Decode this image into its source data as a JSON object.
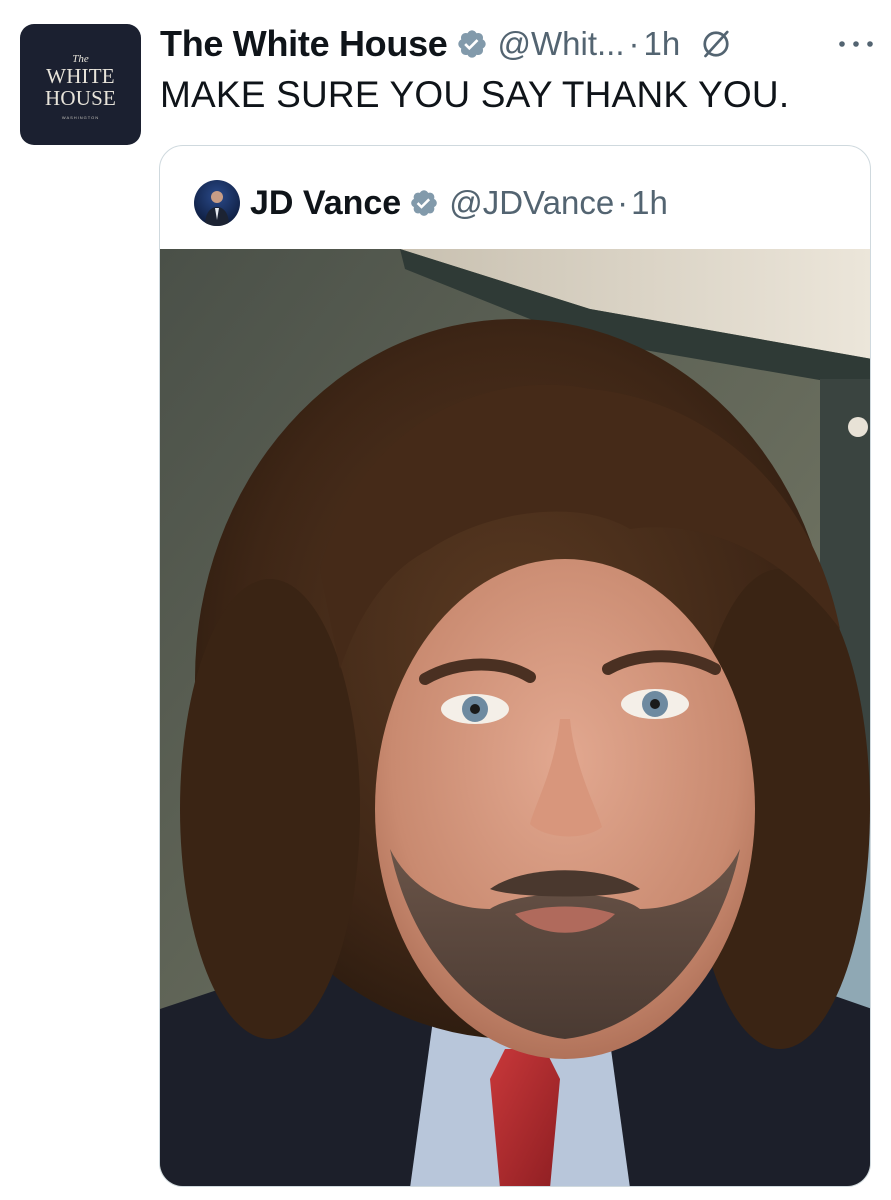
{
  "post": {
    "author": {
      "name": "The White House",
      "handle": "@Whit...",
      "verified": true,
      "avatar_text": {
        "line0": "The",
        "line1": "WHITE",
        "line2": "HOUSE",
        "line3": "WASHINGTON"
      }
    },
    "separator": "·",
    "time": "1h",
    "text": "MAKE SURE YOU SAY THANK YOU."
  },
  "quoted": {
    "author": {
      "name": "JD Vance",
      "handle": "@JDVance",
      "verified": true
    },
    "separator": "·",
    "time": "1h"
  },
  "colors": {
    "text_primary": "#0f1419",
    "text_secondary": "#536471",
    "verified_badge": "#829aab",
    "avatar_bg": "#1b2030",
    "border": "#cfd9de"
  },
  "icons": {
    "verified": "verified-badge-icon",
    "grok": "grok-icon",
    "more": "more-icon"
  }
}
